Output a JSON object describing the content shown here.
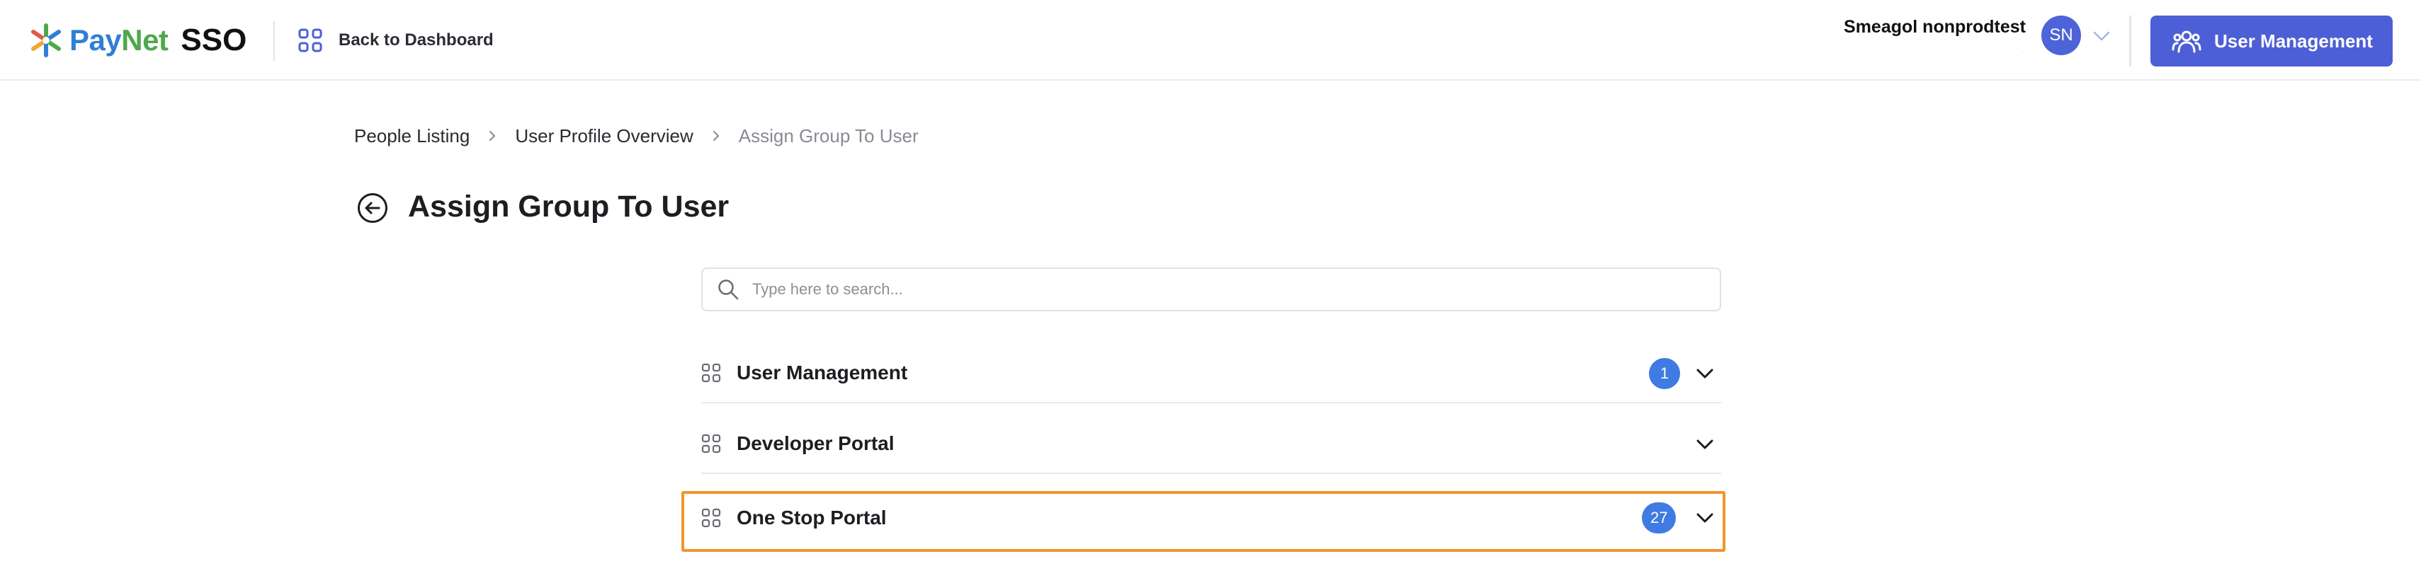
{
  "header": {
    "brand_pay": "Pay",
    "brand_net": "Net",
    "brand_sso": "SSO",
    "back_label": "Back to Dashboard",
    "user_name": "Smeagol nonprodtest",
    "user_sub": ".",
    "avatar_initials": "SN",
    "primary_button_label": "User Management"
  },
  "breadcrumb": {
    "items": [
      "People Listing",
      "User Profile Overview",
      "Assign Group To User"
    ]
  },
  "page": {
    "title": "Assign Group To User"
  },
  "search": {
    "placeholder": "Type here to search...",
    "value": ""
  },
  "groups": [
    {
      "label": "User Management",
      "count": "1",
      "expanded": false
    },
    {
      "label": "Developer Portal",
      "count": null,
      "expanded": false
    },
    {
      "label": "One Stop Portal",
      "count": "27",
      "expanded": false,
      "highlighted": true
    }
  ],
  "colors": {
    "primary": "#4d5fd6",
    "badge": "#3f7be2",
    "highlight": "#f0962c",
    "brand_blue": "#2f7fd6",
    "brand_green": "#4ea84b"
  },
  "icons": {
    "brand": "paynet-star-logo",
    "back": "grid-icon",
    "user_menu": "chevron-down-icon",
    "primary_button": "people-icon",
    "breadcrumb_separator": "chevron-right-icon",
    "title_back": "arrow-left-circle-icon",
    "search": "search-icon",
    "group": "grid-icon",
    "group_toggle": "chevron-down-icon"
  }
}
